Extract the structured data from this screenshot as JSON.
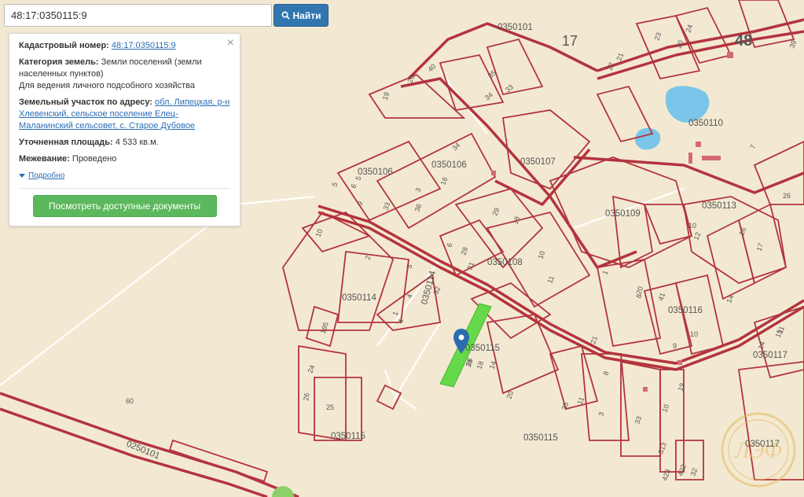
{
  "search": {
    "value": "48:17:0350115:9",
    "button_label": "Найти"
  },
  "panel": {
    "close": "×",
    "cadastral_label": "Кадастровый номер:",
    "cadastral_value": "48:17:0350115:9",
    "category_label": "Категория земель:",
    "category_value": "Земли поселений (земли населенных пунктов)",
    "purpose": "Для ведения личного подсобного хозяйства",
    "address_label": "Земельный участок по адресу:",
    "address_value": "обл. Липецкая, р-н Хлевенский, сельское поселение Елец-Маланинский сельсовет, с. Старое Дубовое",
    "area_label": "Уточненная площадь:",
    "area_value": "4 533 кв.м.",
    "survey_label": "Межевание:",
    "survey_value": "Проведено",
    "more_link": "Подробно",
    "docs_button": "Посмотреть доступные документы"
  },
  "map": {
    "region_labels": [
      "17",
      "48"
    ],
    "quarter_labels": [
      "0350101",
      "0350110",
      "0350106",
      "0350106",
      "0350107",
      "0350109",
      "0350113",
      "0350108",
      "0350114",
      "0350114",
      "0350116",
      "0350115",
      "0350117",
      "0350115",
      "0350115",
      "0350117",
      "0250101"
    ],
    "parcel_numbers": [
      "60",
      "24",
      "26",
      "25",
      "195",
      "10",
      "2",
      "5",
      "4",
      "1",
      "4",
      "32",
      "6",
      "28",
      "31",
      "29",
      "18",
      "10",
      "11",
      "9",
      "5",
      "16",
      "3",
      "5",
      "6",
      "33",
      "36",
      "34",
      "40",
      "20",
      "19",
      "35",
      "34",
      "33",
      "23",
      "20",
      "24",
      "21",
      "22",
      "12",
      "16",
      "17",
      "14",
      "10",
      "8",
      "9",
      "10",
      "19",
      "21",
      "20",
      "8",
      "41",
      "26",
      "7",
      "1",
      "11",
      "14",
      "3",
      "35",
      "11",
      "33",
      "10",
      "313",
      "423",
      "422",
      "32",
      "15",
      "19",
      "18",
      "14",
      "20",
      "16",
      "39"
    ],
    "parcel_highlight_color": "#66d94a",
    "boundary_color": "#b3343e",
    "watermark": "ЛЭФ"
  }
}
